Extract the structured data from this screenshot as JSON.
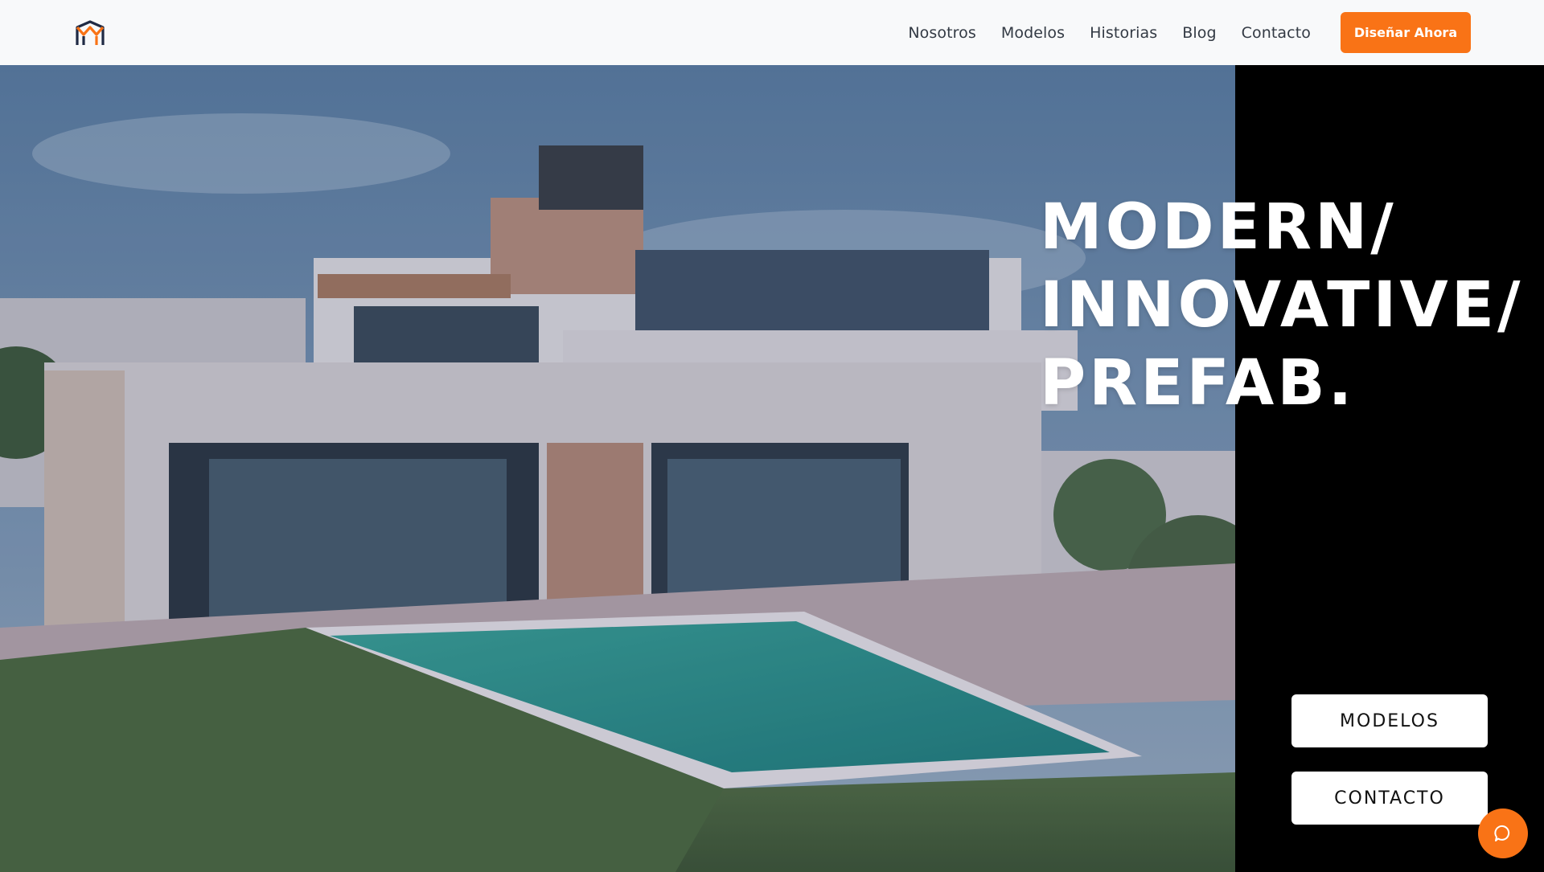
{
  "brand": {
    "logo_icon": "house-m-logo-icon",
    "accent_color": "#f97316",
    "logo_dark": "#1f2a44"
  },
  "nav": {
    "links": [
      "Nosotros",
      "Modelos",
      "Historias",
      "Blog",
      "Contacto"
    ],
    "cta_label": "Diseñar Ahora"
  },
  "hero": {
    "headline": [
      "MODERN/",
      "INNOVATIVE/",
      "PREFAB."
    ],
    "buttons": {
      "models": "MODELOS",
      "contact": "CONTACTO"
    },
    "image_icon": "modern-house-photo"
  },
  "chat": {
    "icon": "chat-icon"
  }
}
